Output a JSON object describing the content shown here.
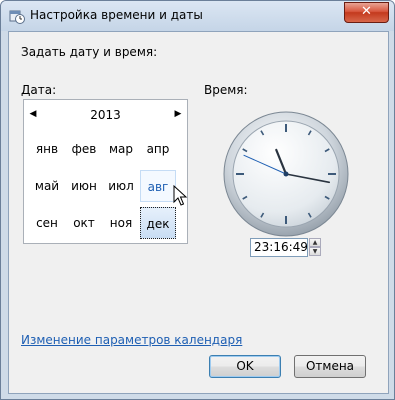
{
  "window": {
    "title": "Настройка времени и даты",
    "close_label": "✕"
  },
  "content": {
    "heading": "Задать дату и время:",
    "date_label": "Дата:",
    "time_label": "Время:"
  },
  "calendar": {
    "year": "2013",
    "prev_glyph": "◀",
    "next_glyph": "▶",
    "months": [
      "янв",
      "фев",
      "мар",
      "апр",
      "май",
      "июн",
      "июл",
      "авг",
      "сен",
      "окт",
      "ноя",
      "дек"
    ],
    "hovered_month": "авг",
    "selected_month": "дек"
  },
  "clock": {
    "hour": 23,
    "minute": 16,
    "second": 49
  },
  "time_field": {
    "value": "23:16:49",
    "spin_up": "▲",
    "spin_down": "▼"
  },
  "link": {
    "text": "Изменение параметров календаря"
  },
  "buttons": {
    "ok": "OK",
    "cancel": "Отмена"
  },
  "colors": {
    "link": "#1e5fb3",
    "selected_bg": "#c9ddf3",
    "hover_text": "#1e5fb3"
  }
}
